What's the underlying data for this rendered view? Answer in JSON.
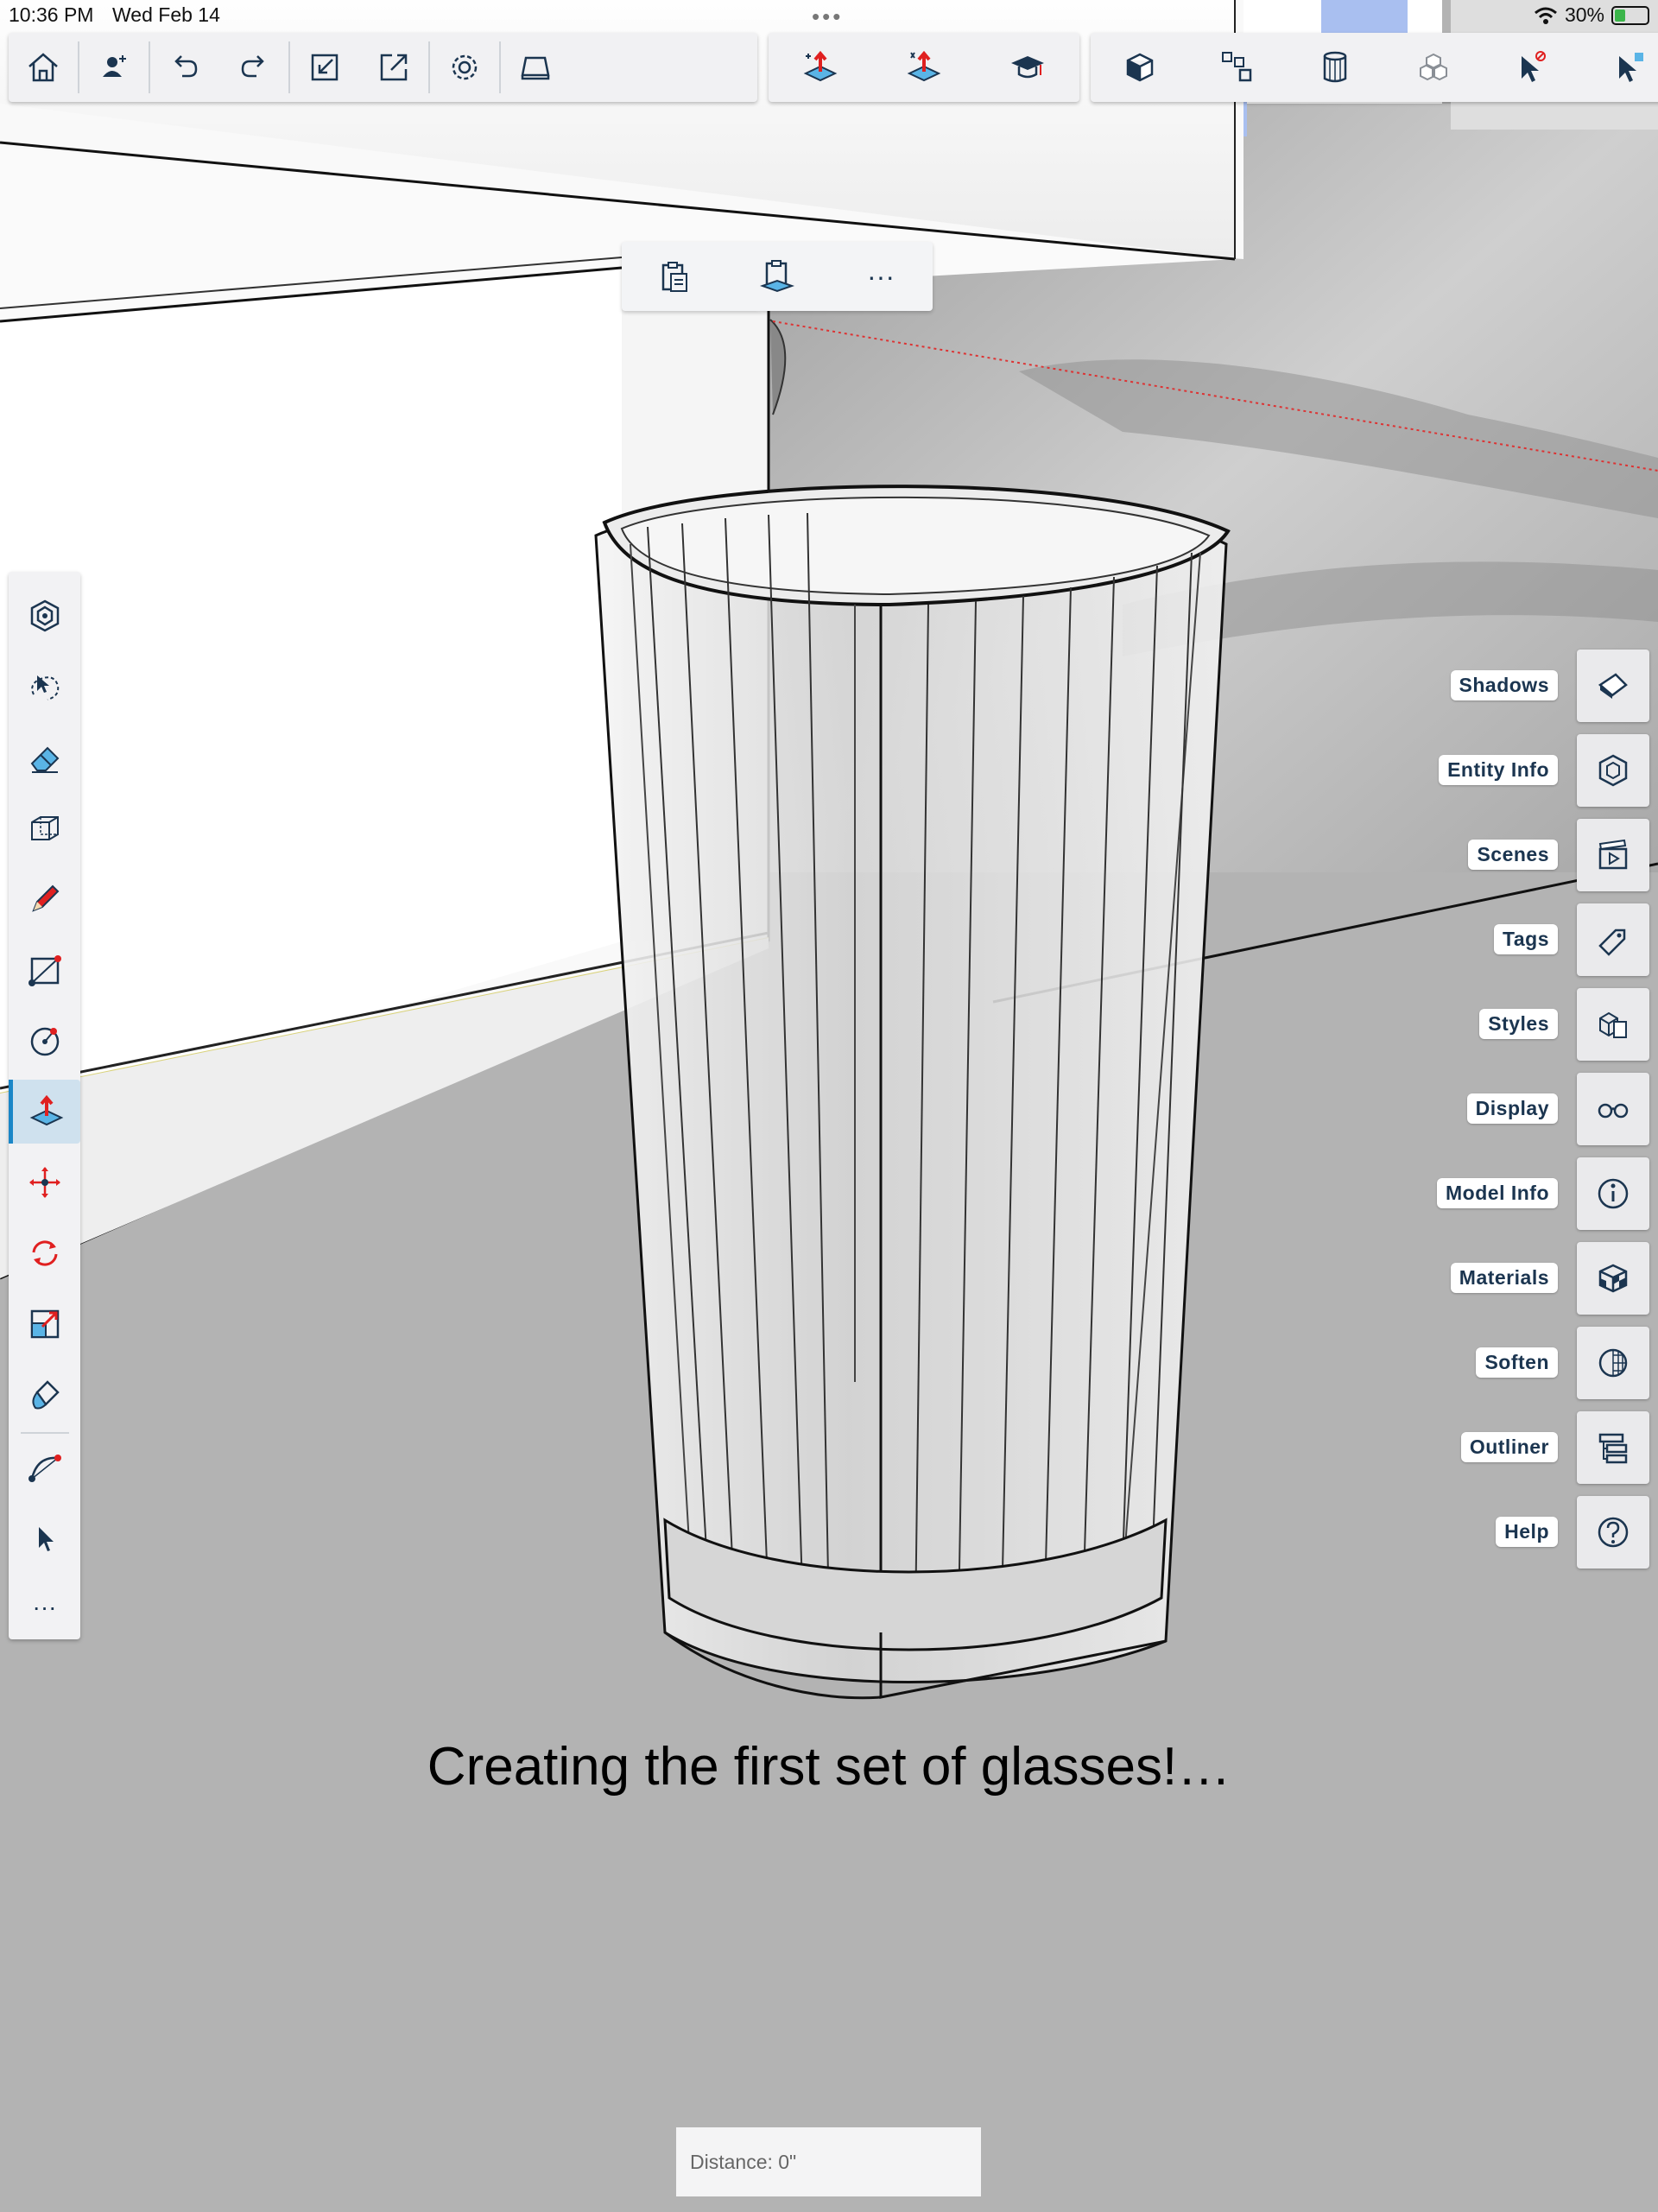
{
  "status_bar": {
    "time": "10:36 PM",
    "date": "Wed Feb 14",
    "battery": "30%",
    "dots": "•••"
  },
  "top_toolbar": {
    "left_group": [
      {
        "name": "home-icon"
      },
      {
        "name": "add-user-icon"
      },
      {
        "name": "undo-icon"
      },
      {
        "name": "redo-icon"
      },
      {
        "name": "import-icon"
      },
      {
        "name": "export-icon"
      },
      {
        "name": "gear-icon"
      },
      {
        "name": "view-icon"
      }
    ],
    "mid_group": [
      {
        "name": "push-pull-icon"
      },
      {
        "name": "push-pull-alt-icon"
      },
      {
        "name": "learn-icon"
      }
    ],
    "right_group": [
      {
        "name": "box-icon"
      },
      {
        "name": "components-icon"
      },
      {
        "name": "cylinder-icon"
      },
      {
        "name": "cubes-icon"
      },
      {
        "name": "select-none-icon"
      }
    ]
  },
  "context_menu": {
    "items": [
      {
        "name": "paste-icon"
      },
      {
        "name": "paste-in-place-icon"
      },
      {
        "name": "more-icon",
        "label": "···"
      }
    ]
  },
  "left_toolbar": {
    "tools": [
      {
        "name": "orbit-icon"
      },
      {
        "name": "lasso-select-icon"
      },
      {
        "name": "eraser-icon"
      },
      {
        "name": "box-select-icon"
      },
      {
        "name": "pencil-icon"
      },
      {
        "name": "rectangle-icon"
      },
      {
        "name": "circle-icon"
      },
      {
        "name": "push-pull-icon",
        "active": true
      },
      {
        "name": "move-icon"
      },
      {
        "name": "rotate-icon"
      },
      {
        "name": "scale-icon"
      },
      {
        "name": "paint-icon"
      },
      {
        "name": "arc-icon"
      },
      {
        "name": "select-icon"
      },
      {
        "name": "more-icon",
        "label": "···"
      }
    ]
  },
  "right_panel": {
    "items": [
      {
        "label": "Shadows",
        "icon": "shadows-icon"
      },
      {
        "label": "Entity Info",
        "icon": "entity-info-icon"
      },
      {
        "label": "Scenes",
        "icon": "scenes-icon"
      },
      {
        "label": "Tags",
        "icon": "tags-icon"
      },
      {
        "label": "Styles",
        "icon": "styles-icon"
      },
      {
        "label": "Display",
        "icon": "display-icon"
      },
      {
        "label": "Model Info",
        "icon": "model-info-icon"
      },
      {
        "label": "Materials",
        "icon": "materials-icon"
      },
      {
        "label": "Soften",
        "icon": "soften-icon"
      },
      {
        "label": "Outliner",
        "icon": "outliner-icon"
      },
      {
        "label": "Help",
        "icon": "help-icon"
      }
    ]
  },
  "caption": "Creating the first set of glasses!…",
  "measurement": {
    "label": "Distance:",
    "value": "0\"",
    "text": "Distance: 0\""
  },
  "colors": {
    "accent": "#1a86c7",
    "icon": "#1b3550",
    "red": "#e02020",
    "ground": "#b3b3b3"
  }
}
